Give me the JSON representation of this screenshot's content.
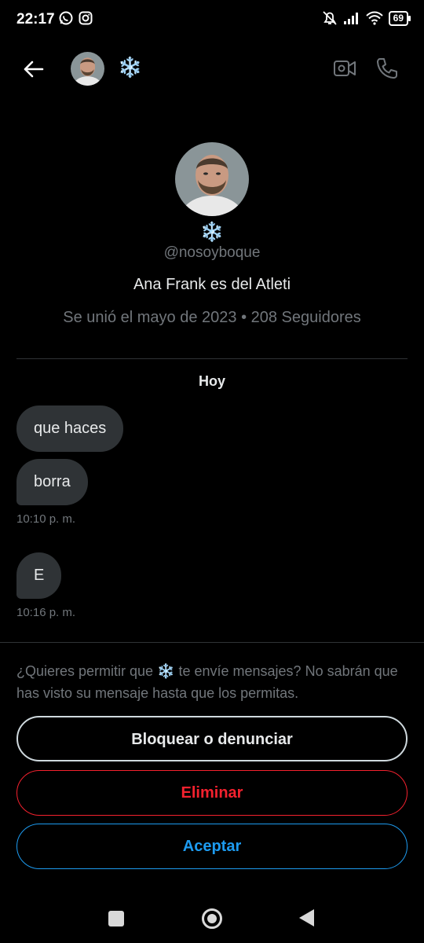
{
  "status_bar": {
    "time": "22:17",
    "left_icons": [
      "whatsapp-icon",
      "instagram-icon"
    ],
    "right_icons": [
      "mute-bell-icon",
      "signal-icon",
      "wifi-icon",
      "battery-icon"
    ],
    "battery": "69"
  },
  "header": {
    "name": "❄️",
    "actions": [
      "video-call-icon",
      "phone-icon"
    ]
  },
  "profile": {
    "name": "❄️",
    "handle": "@nosoyboque",
    "bio": "Ana Frank es del Atleti",
    "meta": "Se unió el mayo de 2023 • 208 Seguidores"
  },
  "conversation": {
    "day_label": "Hoy",
    "messages": [
      {
        "text": "que haces"
      },
      {
        "text": "borra",
        "time": "10:10 p. m."
      },
      {
        "text": "E",
        "time": "10:16 p. m."
      }
    ]
  },
  "request": {
    "notice": "¿Quieres permitir que ❄️ te envíe mensajes? No sabrán que has visto su mensaje hasta que los permitas.",
    "block_label": "Bloquear o denunciar",
    "delete_label": "Eliminar",
    "accept_label": "Aceptar"
  },
  "colors": {
    "background": "#000000",
    "bubble": "#2f3336",
    "muted_text": "#71767b",
    "danger": "#f4212e",
    "accent": "#1d9bf0"
  }
}
